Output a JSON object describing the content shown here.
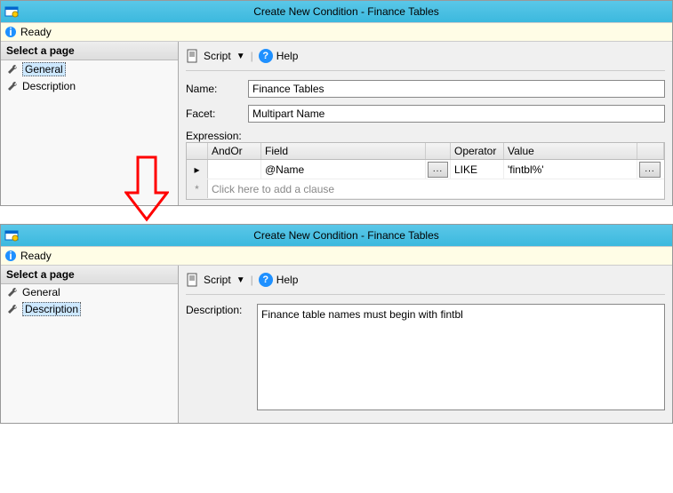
{
  "window_title": "Create New Condition - Finance Tables",
  "status_text": "Ready",
  "sidebar": {
    "heading": "Select a page",
    "items": [
      {
        "label": "General"
      },
      {
        "label": "Description"
      }
    ]
  },
  "toolbar": {
    "script_label": "Script",
    "help_label": "Help"
  },
  "general": {
    "name_label": "Name:",
    "name_value": "Finance Tables",
    "facet_label": "Facet:",
    "facet_value": "Multipart Name",
    "expression_label": "Expression:",
    "grid_headers": {
      "andor": "AndOr",
      "field": "Field",
      "operator": "Operator",
      "value": "Value"
    },
    "rows": [
      {
        "andor": "",
        "field": "@Name",
        "operator": "LIKE",
        "value": "'fintbl%'"
      }
    ],
    "add_clause_placeholder": "Click here to add a clause",
    "browse_btn": "..."
  },
  "description": {
    "label": "Description:",
    "value": "Finance table names must begin with fintbl"
  }
}
